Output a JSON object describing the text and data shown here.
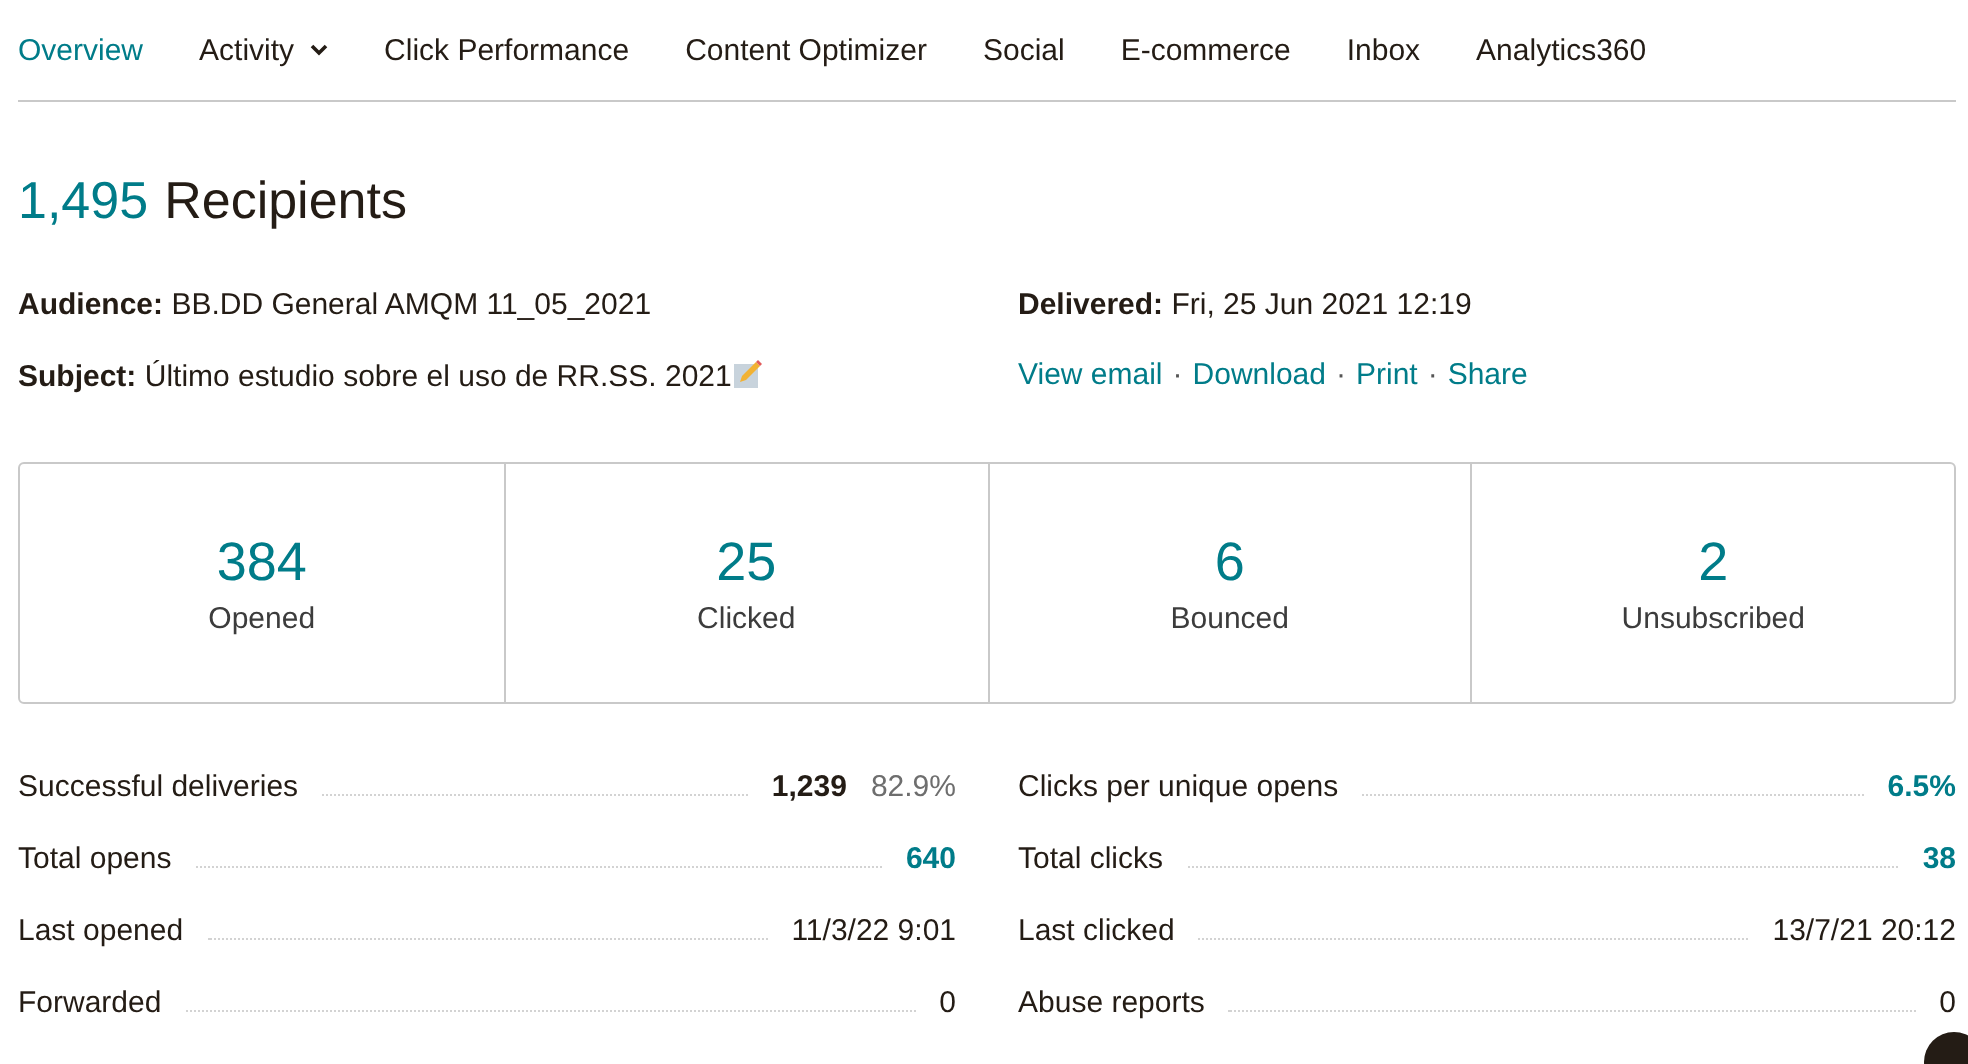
{
  "tabs": [
    {
      "label": "Overview",
      "selected": true,
      "dropdown": false
    },
    {
      "label": "Activity",
      "selected": false,
      "dropdown": true
    },
    {
      "label": "Click Performance",
      "selected": false,
      "dropdown": false
    },
    {
      "label": "Content Optimizer",
      "selected": false,
      "dropdown": false
    },
    {
      "label": "Social",
      "selected": false,
      "dropdown": false
    },
    {
      "label": "E-commerce",
      "selected": false,
      "dropdown": false
    },
    {
      "label": "Inbox",
      "selected": false,
      "dropdown": false
    },
    {
      "label": "Analytics360",
      "selected": false,
      "dropdown": false
    }
  ],
  "heading": {
    "count": "1,495",
    "label": "Recipients"
  },
  "details": {
    "audience": {
      "label": "Audience:",
      "value": "BB.DD General AMQM 11_05_2021"
    },
    "subject": {
      "label": "Subject:",
      "value": "Último estudio sobre el uso de RR.SS. 2021"
    },
    "delivered": {
      "label": "Delivered:",
      "value": "Fri, 25 Jun 2021 12:19"
    },
    "links": [
      "View email",
      "Download",
      "Print",
      "Share"
    ],
    "link_separator": "·"
  },
  "cards": [
    {
      "value": "384",
      "label": "Opened"
    },
    {
      "value": "25",
      "label": "Clicked"
    },
    {
      "value": "6",
      "label": "Bounced"
    },
    {
      "value": "2",
      "label": "Unsubscribed"
    }
  ],
  "stats_left": [
    {
      "label": "Successful deliveries",
      "value": "1,239",
      "secondary": "82.9%",
      "kind": "bold"
    },
    {
      "label": "Total opens",
      "value": "640",
      "kind": "link"
    },
    {
      "label": "Last opened",
      "value": "11/3/22 9:01",
      "kind": "plain"
    },
    {
      "label": "Forwarded",
      "value": "0",
      "kind": "plain"
    }
  ],
  "stats_right": [
    {
      "label": "Clicks per unique opens",
      "value": "6.5%",
      "kind": "link"
    },
    {
      "label": "Total clicks",
      "value": "38",
      "kind": "link"
    },
    {
      "label": "Last clicked",
      "value": "13/7/21 20:12",
      "kind": "plain"
    },
    {
      "label": "Abuse reports",
      "value": "0",
      "kind": "plain"
    }
  ]
}
